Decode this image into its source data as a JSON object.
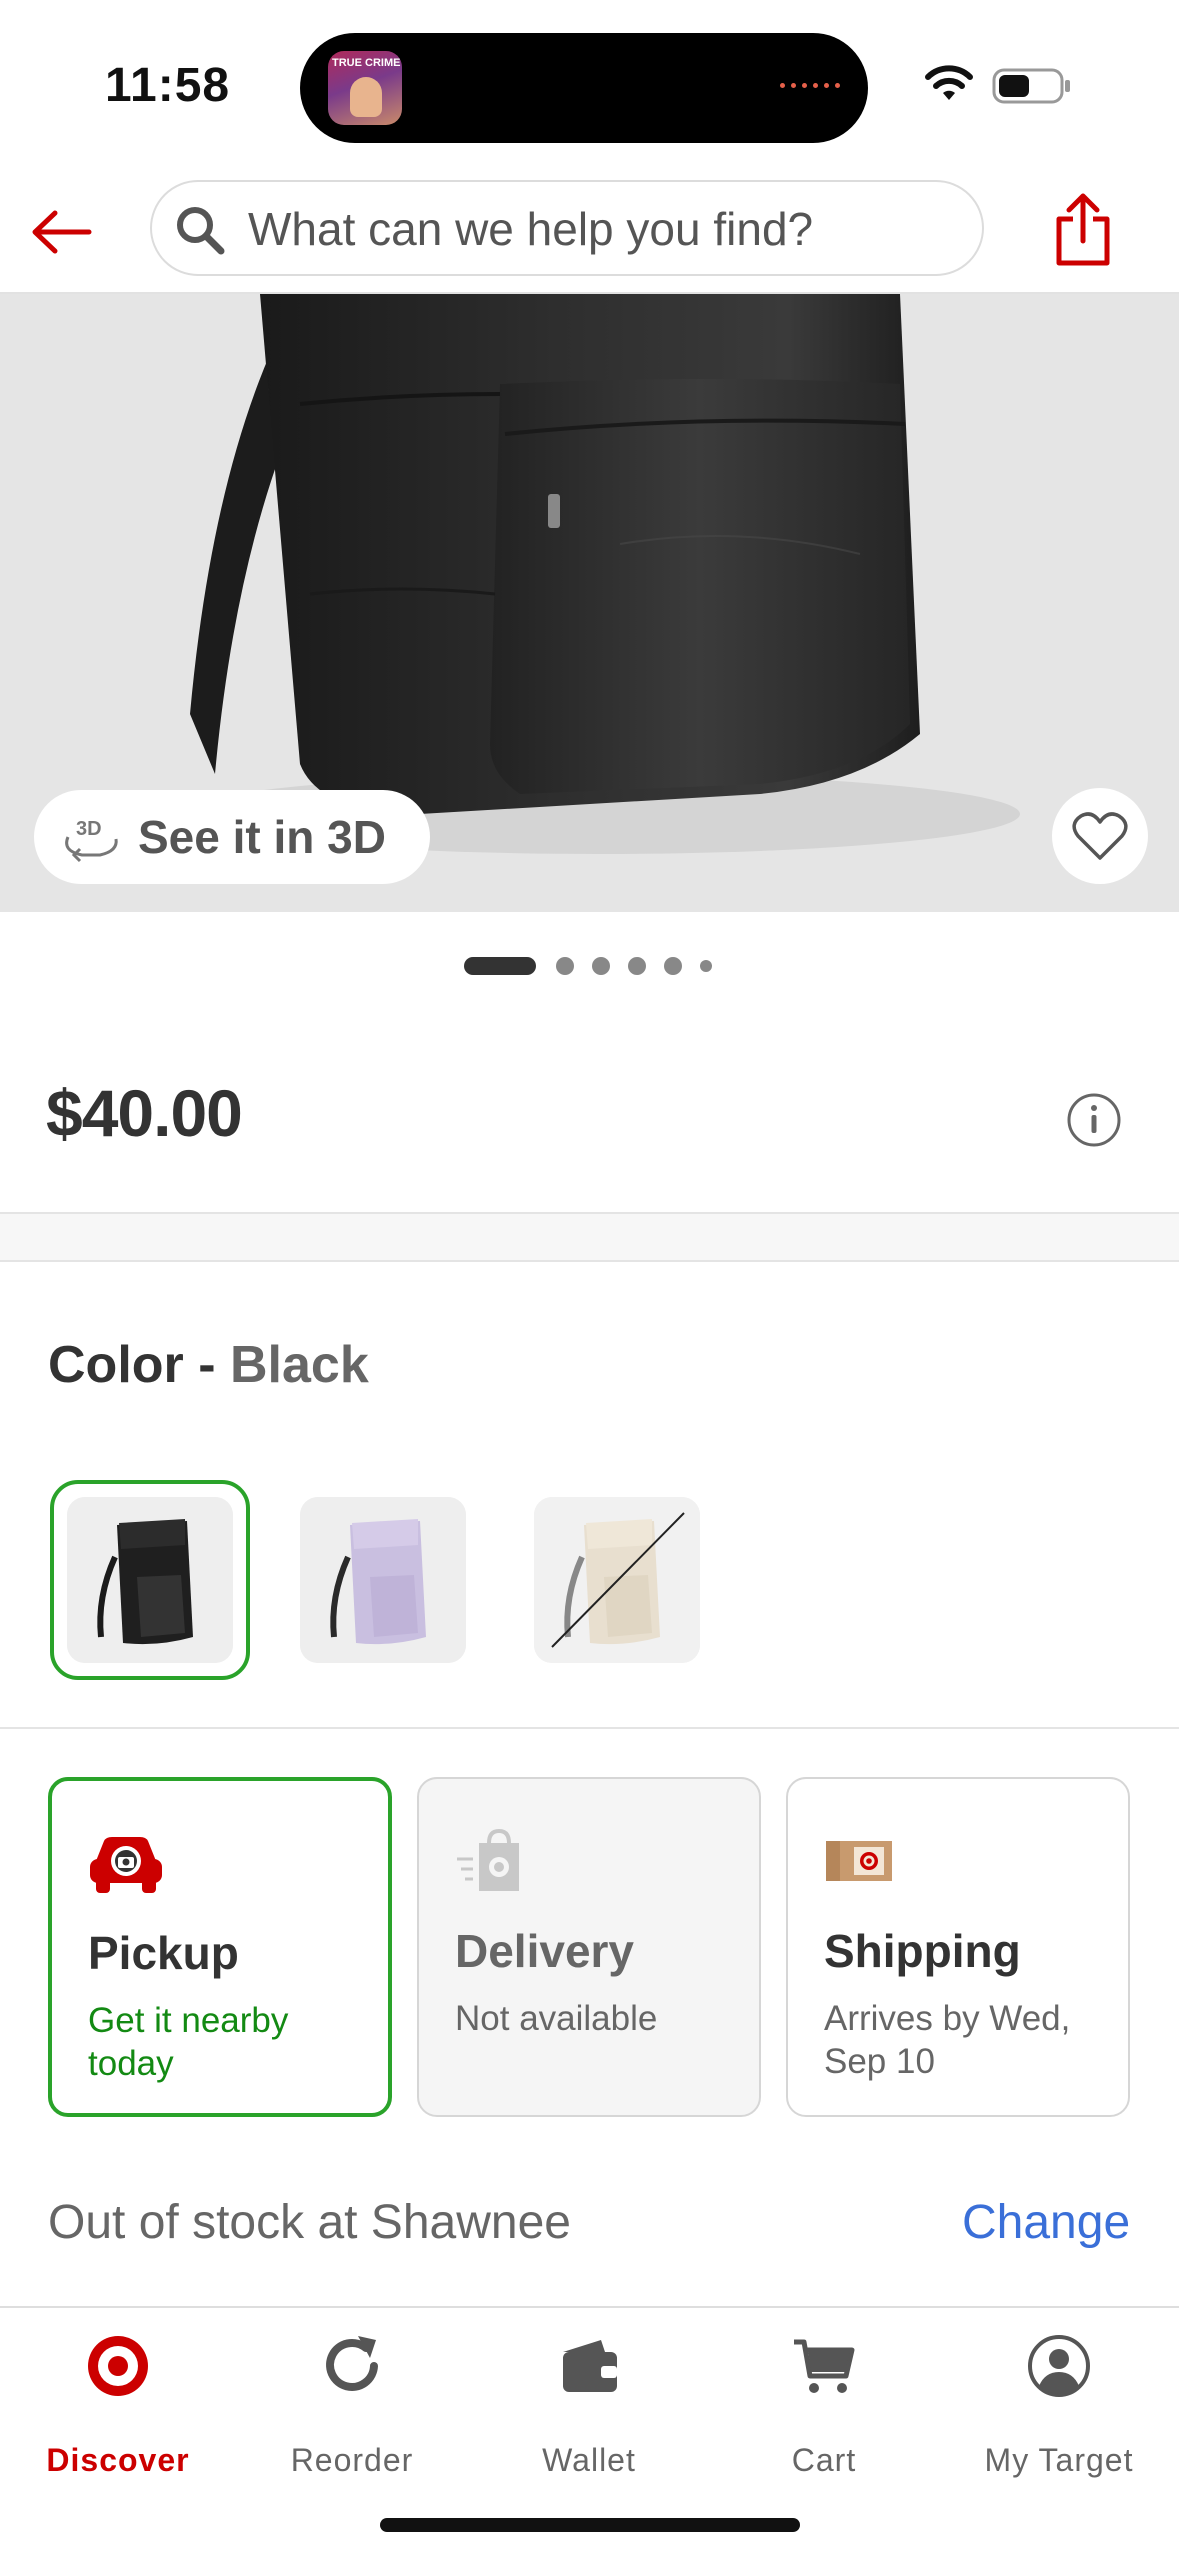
{
  "status_bar": {
    "time": "11:58",
    "now_playing_label": "TRUE CRIME"
  },
  "header": {
    "back_icon": "arrow-left-icon",
    "search": {
      "placeholder": "What can we help you find?",
      "value": ""
    },
    "share_icon": "share-icon"
  },
  "hero": {
    "see_3d_label": "See it in 3D",
    "favorite_icon": "heart-icon",
    "image_index": 1,
    "image_count": 6
  },
  "product": {
    "price": "$40.00"
  },
  "color": {
    "label": "Color",
    "separator": " - ",
    "selected": "Black",
    "swatches": [
      {
        "name": "Black",
        "selected": true,
        "available": true
      },
      {
        "name": "Lavender",
        "selected": false,
        "available": true
      },
      {
        "name": "Cream",
        "selected": false,
        "available": false
      }
    ]
  },
  "fulfillment": {
    "pickup": {
      "title": "Pickup",
      "subtitle": "Get it nearby today",
      "selected": true
    },
    "delivery": {
      "title": "Delivery",
      "subtitle": "Not available",
      "available": false
    },
    "shipping": {
      "title": "Shipping",
      "subtitle": "Arrives by Wed, Sep 10"
    }
  },
  "store": {
    "stock_text": "Out of stock at Shawnee",
    "change_label": "Change"
  },
  "bottom_nav": {
    "items": [
      {
        "label": "Discover",
        "icon": "target-logo-icon",
        "active": true
      },
      {
        "label": "Reorder",
        "icon": "reorder-icon",
        "active": false
      },
      {
        "label": "Wallet",
        "icon": "wallet-icon",
        "active": false
      },
      {
        "label": "Cart",
        "icon": "cart-icon",
        "active": false
      },
      {
        "label": "My Target",
        "icon": "account-icon",
        "active": false
      }
    ]
  },
  "colors": {
    "brand_red": "#cc0000",
    "selected_green": "#2aa32a",
    "link_blue": "#3a6fd8"
  }
}
